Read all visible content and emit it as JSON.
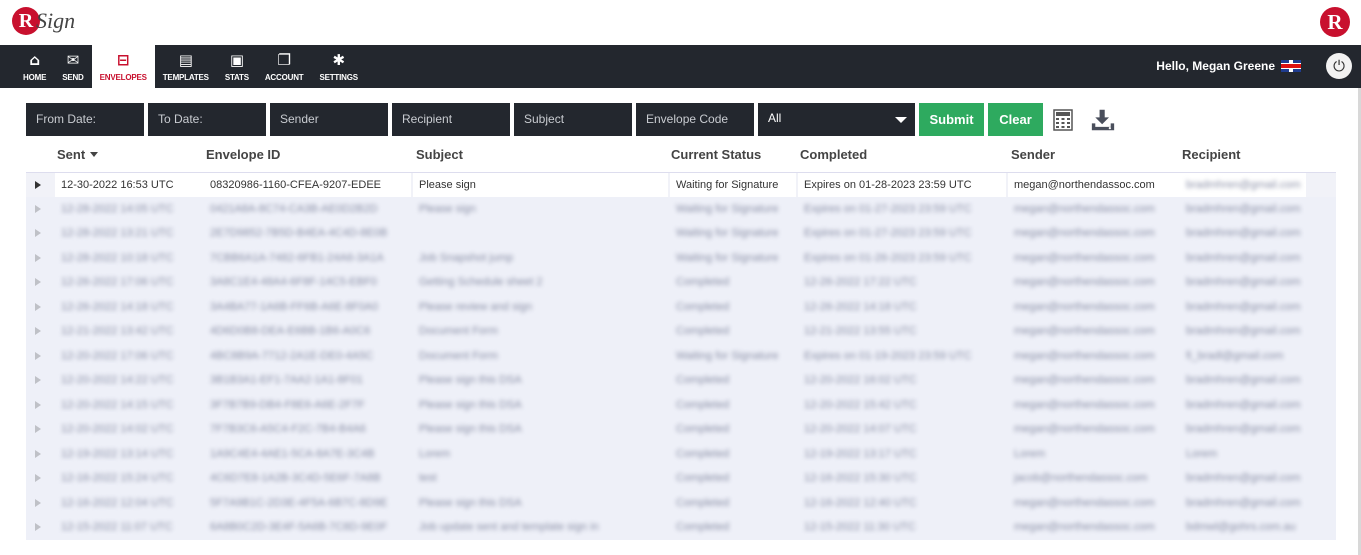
{
  "app": {
    "logo_text": "R",
    "logo_word": "Sign",
    "logo_right": "R"
  },
  "nav": {
    "items": [
      {
        "label": "HOME",
        "icon": "home-icon",
        "glyph": "⌂"
      },
      {
        "label": "SEND",
        "icon": "mail-icon",
        "glyph": "✉"
      },
      {
        "label": "ENVELOPES",
        "icon": "envelopes-icon",
        "glyph": "⊟"
      },
      {
        "label": "TEMPLATES",
        "icon": "templates-icon",
        "glyph": "▤"
      },
      {
        "label": "STATS",
        "icon": "stats-icon",
        "glyph": "▣"
      },
      {
        "label": "ACCOUNT",
        "icon": "account-icon",
        "glyph": "❐"
      },
      {
        "label": "SETTINGS",
        "icon": "gear-icon",
        "glyph": "✱"
      }
    ],
    "active": "ENVELOPES"
  },
  "user": {
    "greeting": "Hello, Megan Greene",
    "flag": "uk-flag-icon",
    "power_glyph": "⏻"
  },
  "filters": {
    "from_date": "From Date:",
    "to_date": "To Date:",
    "sender": "Sender",
    "recipient": "Recipient",
    "subject": "Subject",
    "envelope_code": "Envelope Code",
    "status_select": "All",
    "submit": "Submit",
    "clear": "Clear"
  },
  "columns": {
    "sent": "Sent",
    "envelope_id": "Envelope ID",
    "subject": "Subject",
    "status": "Current Status",
    "completed": "Completed",
    "sender": "Sender",
    "recipient": "Recipient"
  },
  "rows": [
    {
      "sent": "12-30-2022 16:53 UTC",
      "envelope_id": "08320986-1160-CFEA-9207-EDEE",
      "subject": "Please sign",
      "status": "Waiting for Signature",
      "completed": "Expires on 01-28-2023 23:59 UTC",
      "sender": "megan@northendassoc.com",
      "recipient": "bradmhren@gmail.com"
    },
    {
      "sent": "12-28-2022 14:05 UTC",
      "envelope_id": "0421A8A-8C74-CA3B-AE0D2B2D",
      "subject": "Please sign",
      "status": "Waiting for Signature",
      "completed": "Expires on 01-27-2023 23:59 UTC",
      "sender": "megan@northendassoc.com",
      "recipient": "bradmhren@gmail.com"
    },
    {
      "sent": "12-28-2022 13:21 UTC",
      "envelope_id": "2E7D9852-7B5D-B4EA-4C4D-8E0B",
      "subject": "",
      "status": "Waiting for Signature",
      "completed": "Expires on 01-27-2023 23:59 UTC",
      "sender": "megan@northendassoc.com",
      "recipient": "bradmhren@gmail.com"
    },
    {
      "sent": "12-28-2022 10:18 UTC",
      "envelope_id": "7CBB6A1A-7482-6FB1-24A6-3A1A",
      "subject": "Job Snapshot jump",
      "status": "Waiting for Signature",
      "completed": "Expires on 01-26-2023 23:59 UTC",
      "sender": "megan@northendassoc.com",
      "recipient": "bradmhren@gmail.com"
    },
    {
      "sent": "12-26-2022 17:06 UTC",
      "envelope_id": "3A8C1E4-48A4-6F8F-14C5-EBF0",
      "subject": "Getting Schedule sheet 2",
      "status": "Completed",
      "completed": "12-26-2022 17:22 UTC",
      "sender": "megan@northendassoc.com",
      "recipient": "bradmhren@gmail.com"
    },
    {
      "sent": "12-26-2022 14:18 UTC",
      "envelope_id": "3A4BA77-1A6B-FF6B-A6E-8F0A0",
      "subject": "Please review and sign",
      "status": "Completed",
      "completed": "12-26-2022 14:18 UTC",
      "sender": "megan@northendassoc.com",
      "recipient": "bradmhren@gmail.com"
    },
    {
      "sent": "12-21-2022 13:42 UTC",
      "envelope_id": "4D6D0B8-DEA-E6BB-1B6-A0C6",
      "subject": "Document Form",
      "status": "Completed",
      "completed": "12-21-2022 13:55 UTC",
      "sender": "megan@northendassoc.com",
      "recipient": "bradmhren@gmail.com"
    },
    {
      "sent": "12-20-2022 17:06 UTC",
      "envelope_id": "4BC8B9A-7712-2A1E-DE0-4A5C",
      "subject": "Document Form",
      "status": "Waiting for Signature",
      "completed": "Expires on 01-19-2023 23:59 UTC",
      "sender": "megan@northendassoc.com",
      "recipient": "fi_bradl@gmail.com"
    },
    {
      "sent": "12-20-2022 14:22 UTC",
      "envelope_id": "3B1B3A1-EF1-7AA2-1A1-8F01",
      "subject": "Please sign this DSA",
      "status": "Completed",
      "completed": "12-20-2022 16:02 UTC",
      "sender": "megan@northendassoc.com",
      "recipient": "bradmhren@gmail.com"
    },
    {
      "sent": "12-20-2022 14:15 UTC",
      "envelope_id": "3F7B7B9-DB4-F8E6-A6E-2F7F",
      "subject": "Please sign this DSA",
      "status": "Completed",
      "completed": "12-20-2022 15:42 UTC",
      "sender": "megan@northendassoc.com",
      "recipient": "bradmhren@gmail.com"
    },
    {
      "sent": "12-20-2022 14:02 UTC",
      "envelope_id": "7F7B3C6-A5C4-F2C-7B4-B4A6",
      "subject": "Please sign this DSA",
      "status": "Completed",
      "completed": "12-20-2022 14:07 UTC",
      "sender": "megan@northendassoc.com",
      "recipient": "bradmhren@gmail.com"
    },
    {
      "sent": "12-19-2022 13:14 UTC",
      "envelope_id": "1A9C4E4-4AE1-5CA-8A7E-3C4B",
      "subject": "Lorem",
      "status": "Completed",
      "completed": "12-19-2022 13:17 UTC",
      "sender": "Lorem",
      "recipient": "Lorem"
    },
    {
      "sent": "12-16-2022 15:24 UTC",
      "envelope_id": "4C6D7E8-1A2B-3C4D-5E6F-7A8B",
      "subject": "test",
      "status": "Completed",
      "completed": "12-16-2022 15:30 UTC",
      "sender": "jacob@northendassoc.com",
      "recipient": "bradmhren@gmail.com"
    },
    {
      "sent": "12-16-2022 12:04 UTC",
      "envelope_id": "5F7A9B1C-2D3E-4F5A-6B7C-8D9E",
      "subject": "Please sign this DSA",
      "status": "Completed",
      "completed": "12-16-2022 12:40 UTC",
      "sender": "megan@northendassoc.com",
      "recipient": "bradmhren@gmail.com"
    },
    {
      "sent": "12-15-2022 11:07 UTC",
      "envelope_id": "6A8B0C2D-3E4F-5A6B-7C8D-9E0F",
      "subject": "Job update sent and template sign in",
      "status": "Completed",
      "completed": "12-15-2022 11:30 UTC",
      "sender": "megan@northendassoc.com",
      "recipient": "bdmwl@gohrs.com.au"
    }
  ]
}
